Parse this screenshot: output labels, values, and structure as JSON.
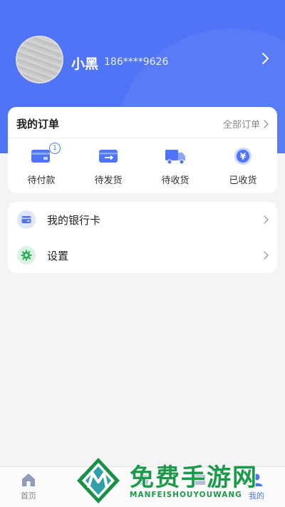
{
  "profile": {
    "name": "小黑",
    "phone": "186****9626"
  },
  "orders": {
    "title": "我的订单",
    "all_label": "全部订单",
    "items": [
      {
        "label": "待付款",
        "icon": "wallet-icon",
        "badge": "1"
      },
      {
        "label": "待发货",
        "icon": "package-send-icon"
      },
      {
        "label": "待收货",
        "icon": "delivery-truck-icon"
      },
      {
        "label": "已收货",
        "icon": "yen-coin-icon"
      }
    ]
  },
  "menu": {
    "items": [
      {
        "label": "我的银行卡",
        "icon": "bank-card-icon"
      },
      {
        "label": "设置",
        "icon": "settings-gear-icon"
      }
    ]
  },
  "tabbar": {
    "tabs": [
      {
        "label": "首页",
        "icon": "home-icon"
      },
      {
        "label": "",
        "icon": "discover-icon"
      },
      {
        "label": "",
        "icon": "share-icon"
      },
      {
        "label": "",
        "icon": "study-icon"
      },
      {
        "label": "我的",
        "icon": "profile-icon"
      }
    ]
  },
  "watermark": {
    "title": "免费手游网",
    "subtitle": "MANFEISHOUYOUWANG"
  },
  "colors": {
    "primary": "#4f74f6",
    "background": "#f3f4f6",
    "watermark": "#1b9a4a"
  }
}
